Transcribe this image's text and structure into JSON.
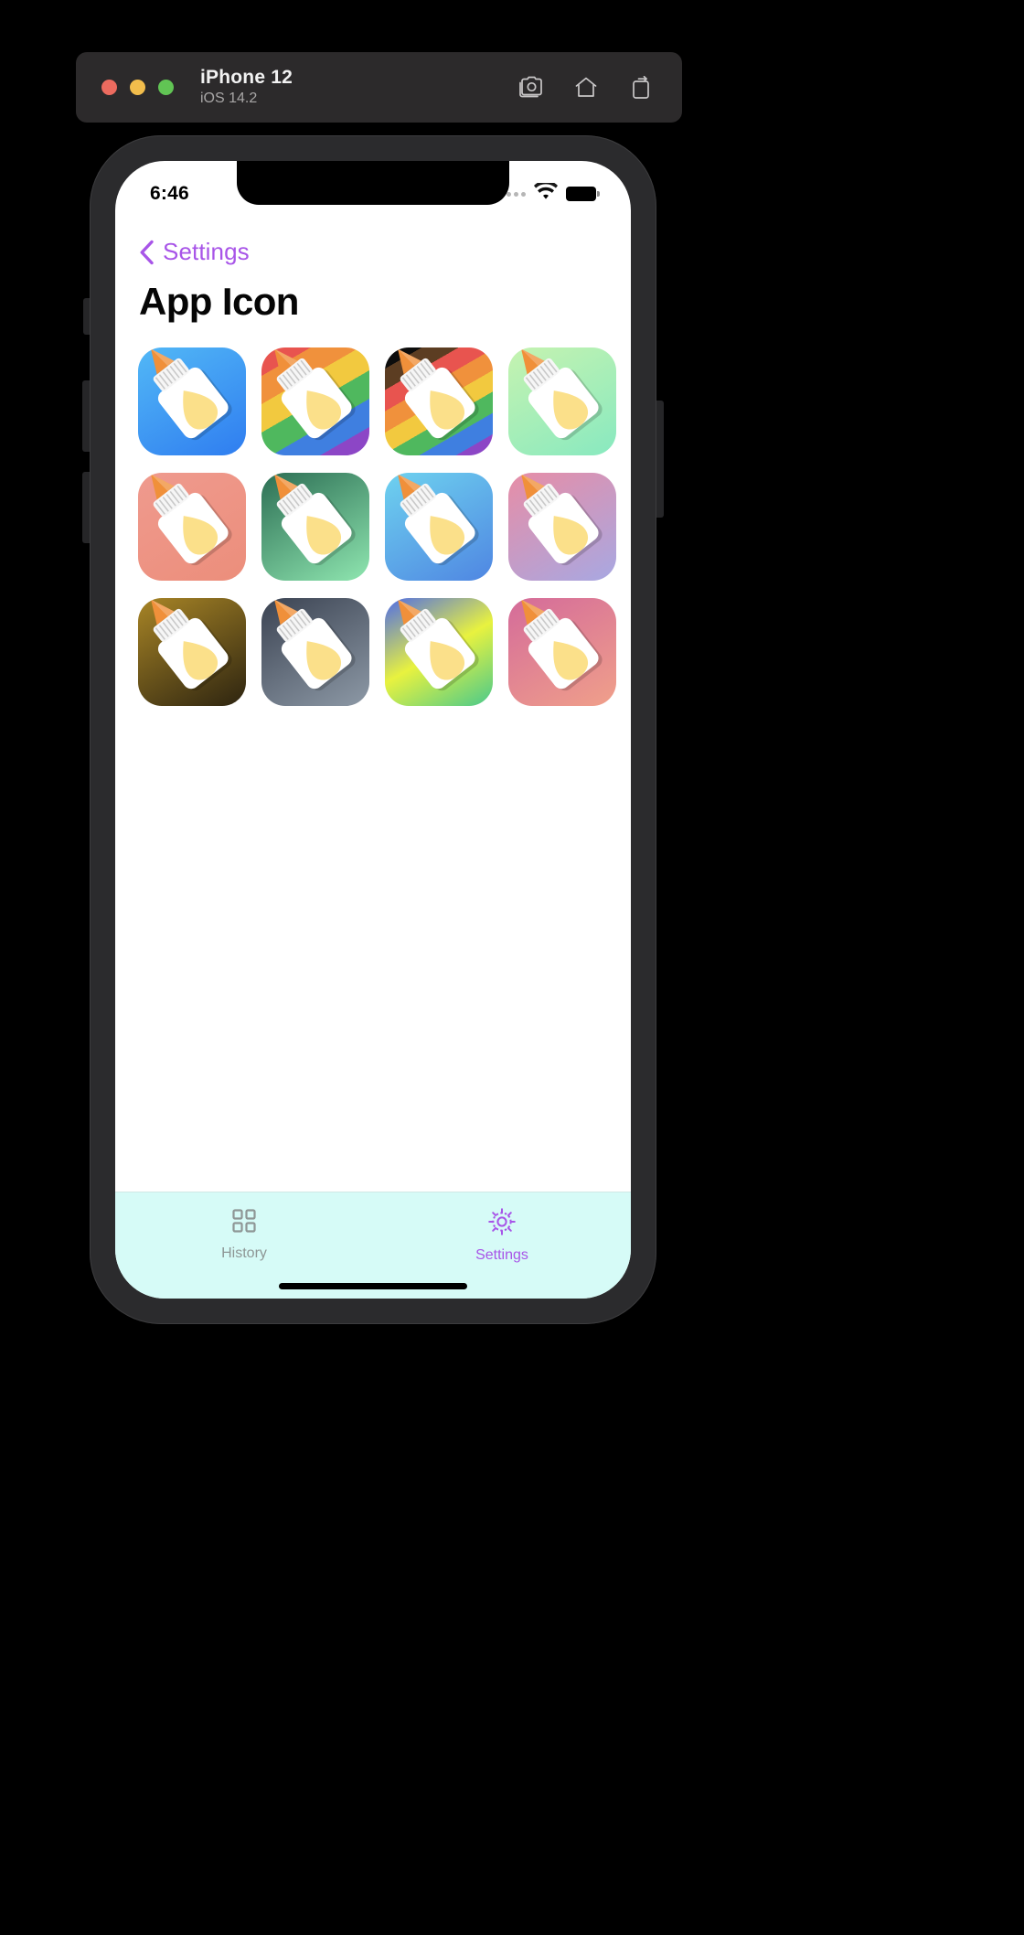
{
  "simulator": {
    "device_name": "iPhone 12",
    "os_version": "iOS 14.2",
    "traffic_lights": [
      {
        "name": "close-button",
        "color": "#ec6b5f"
      },
      {
        "name": "minimize-button",
        "color": "#f2bd4c"
      },
      {
        "name": "zoom-button",
        "color": "#61c454"
      }
    ],
    "toolbar": [
      {
        "icon": "screenshot-icon",
        "label": "Screenshot"
      },
      {
        "icon": "home-icon",
        "label": "Home"
      },
      {
        "icon": "rotate-icon",
        "label": "Rotate"
      }
    ]
  },
  "status_bar": {
    "time": "6:46",
    "signal_icon": "signal-dots-icon",
    "wifi_icon": "wifi-icon",
    "battery_icon": "battery-icon"
  },
  "nav": {
    "back_icon": "chevron-left-icon",
    "back_label": "Settings",
    "accent_color": "#a855e8"
  },
  "page": {
    "title": "App Icon"
  },
  "app_icons": [
    {
      "name": "app-icon-blue",
      "label": "Blue",
      "colors": [
        "#52b8f6",
        "#2f7df0"
      ],
      "angle": 150,
      "pen_body": "#ffffff",
      "pen_ink": "#fbe08a",
      "tip": "#f0903a"
    },
    {
      "name": "app-icon-pride",
      "label": "Pride",
      "colors": [
        "#e8544f",
        "#f0913c",
        "#f2c93f",
        "#4fb85e",
        "#3f7fe0",
        "#8c46c6"
      ],
      "angle": 150,
      "pen_body": "#ffffff",
      "pen_ink": "#fbe08a",
      "tip": "#f0903a"
    },
    {
      "name": "app-icon-pride-dark",
      "label": "Pride Dark",
      "colors": [
        "#0d0d0d",
        "#5c3d22",
        "#e8544f",
        "#f0913c",
        "#f2c93f",
        "#4fb85e",
        "#3f7fe0",
        "#8c46c6"
      ],
      "angle": 150,
      "pen_body": "#ffffff",
      "pen_ink": "#fbe08a",
      "tip": "#f0903a"
    },
    {
      "name": "app-icon-mint",
      "label": "Mint",
      "colors": [
        "#c6f3b0",
        "#88e9c0"
      ],
      "angle": 150,
      "pen_body": "#ffffff",
      "pen_ink": "#fbe08a",
      "tip": "#f0903a"
    },
    {
      "name": "app-icon-salmon",
      "label": "Salmon",
      "colors": [
        "#ef9a8e",
        "#ec8e7b"
      ],
      "angle": 150,
      "pen_body": "#ffffff",
      "pen_ink": "#fbe08a",
      "tip": "#f0903a"
    },
    {
      "name": "app-icon-forest",
      "label": "Forest",
      "colors": [
        "#2c6e54",
        "#8fe6b0"
      ],
      "angle": 150,
      "pen_body": "#ffffff",
      "pen_ink": "#fbe08a",
      "tip": "#f0903a"
    },
    {
      "name": "app-icon-sky",
      "label": "Sky",
      "colors": [
        "#6ed2ef",
        "#4f86e2"
      ],
      "angle": 150,
      "pen_body": "#ffffff",
      "pen_ink": "#fbe08a",
      "tip": "#f0903a"
    },
    {
      "name": "app-icon-rose",
      "label": "Rose",
      "colors": [
        "#e78da6",
        "#a8a8e2"
      ],
      "angle": 150,
      "pen_body": "#ffffff",
      "pen_ink": "#fbe08a",
      "tip": "#f0903a"
    },
    {
      "name": "app-icon-gold",
      "label": "Gold",
      "colors": [
        "#a88526",
        "#2d2410"
      ],
      "angle": 150,
      "pen_body": "#ffffff",
      "pen_ink": "#fbe08a",
      "tip": "#f0903a"
    },
    {
      "name": "app-icon-slate",
      "label": "Slate",
      "colors": [
        "#3b4352",
        "#8d99a6"
      ],
      "angle": 150,
      "pen_body": "#ffffff",
      "pen_ink": "#fbe08a",
      "tip": "#f0903a"
    },
    {
      "name": "app-icon-neon",
      "label": "Neon",
      "colors": [
        "#4f6ce8",
        "#e8f23f",
        "#49c98c"
      ],
      "angle": 150,
      "pen_body": "#ffffff",
      "pen_ink": "#fbe08a",
      "tip": "#f0903a"
    },
    {
      "name": "app-icon-blush",
      "label": "Blush",
      "colors": [
        "#d46b9a",
        "#f0a08a"
      ],
      "angle": 150,
      "pen_body": "#ffffff",
      "pen_ink": "#fbe08a",
      "tip": "#f0903a"
    }
  ],
  "tab_bar": {
    "background_color": "#d6fbf7",
    "items": [
      {
        "name": "tab-history",
        "icon": "grid-icon",
        "label": "History",
        "selected": false,
        "color": "#8e9695"
      },
      {
        "name": "tab-settings",
        "icon": "gear-icon",
        "label": "Settings",
        "selected": true,
        "color": "#a855e8"
      }
    ]
  }
}
